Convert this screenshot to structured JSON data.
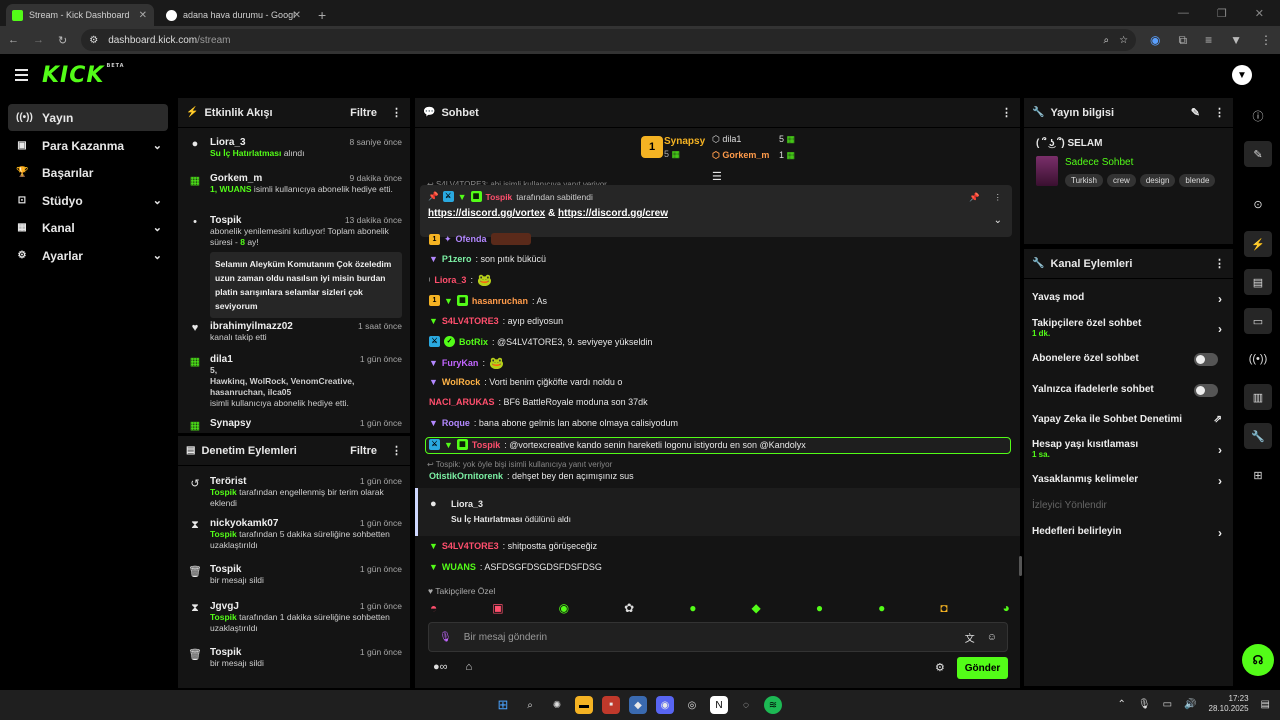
{
  "browser": {
    "tabs": [
      {
        "title": "Stream - Kick Dashboard",
        "active": true
      },
      {
        "title": "adana hava durumu - Google'd",
        "active": false
      }
    ],
    "new_tab": "+",
    "url_host": "dashboard.kick.com",
    "url_path": "/stream"
  },
  "brand": {
    "logo": "KICK",
    "logo_sup": "BETA",
    "accent": "#53fc18"
  },
  "nav": {
    "items": [
      {
        "label": "Yayın",
        "icon": "broadcast-icon",
        "active": true
      },
      {
        "label": "Para Kazanma",
        "icon": "money-icon",
        "expand": true
      },
      {
        "label": "Başarılar",
        "icon": "trophy-icon"
      },
      {
        "label": "Stüdyo",
        "icon": "studio-icon",
        "expand": true
      },
      {
        "label": "Kanal",
        "icon": "channel-icon",
        "expand": true
      },
      {
        "label": "Ayarlar",
        "icon": "settings-icon",
        "expand": true
      }
    ]
  },
  "activity": {
    "title": "Etkinlik Akışı",
    "filter": "Filtre",
    "items": [
      {
        "name": "Liora_3",
        "time": "8 saniye önce",
        "reward": "Su İç Hatırlatması",
        "text": " alındı"
      },
      {
        "name": "Gorkem_m",
        "time": "9 dakika önce",
        "count": "1, WUANS",
        "text": " isimli kullanıcıya abonelik hediye etti."
      },
      {
        "name": "Tospik",
        "time": "13 dakika önce",
        "text": "abonelik yenilemesini kutluyor! Toplam abonelik süresi - ",
        "months": "8",
        "suffix": " ay!",
        "quote": "Selamın Aleyküm Komutanım Çok özeledim uzun zaman oldu nasılsın iyi misin burdan platin sarışınlara selamlar sizleri çok seviyorum"
      },
      {
        "name": "ibrahimyilmazz02",
        "time": "1 saat önce",
        "text": "kanalı takip etti"
      },
      {
        "name": "dila1",
        "time": "1 gün önce",
        "count": "5,",
        "users": "Hawkinq, WolRock, VenomCreative, hasanruchan, ilca05",
        "text": "isimli kullanıcıya abonelik hediye etti."
      },
      {
        "name": "Synapsy",
        "time": "1 gün önce"
      }
    ]
  },
  "moderation": {
    "title": "Denetim Eylemleri",
    "filter": "Filtre",
    "items": [
      {
        "name": "Terörist",
        "time": "1 gün önce",
        "by": "Tospik",
        "text": " tarafından engellenmiş bir terim olarak eklendi",
        "icon": "undo-icon"
      },
      {
        "name": "nickyokamk07",
        "time": "1 gün önce",
        "by": "Tospik",
        "text": " tarafından 5 dakika süreliğine sohbetten uzaklaştırıldı",
        "icon": "hourglass-icon"
      },
      {
        "name": "Tospik",
        "time": "1 gün önce",
        "text": "bir mesajı sildi",
        "icon": "trash-icon"
      },
      {
        "name": "JgvgJ",
        "time": "1 gün önce",
        "by": "Tospik",
        "text": " tarafından 1 dakika süreliğine sohbetten uzaklaştırıldı",
        "icon": "hourglass-icon"
      },
      {
        "name": "Tospik",
        "time": "1 gün önce",
        "text": "bir mesajı sildi",
        "icon": "trash-icon"
      }
    ]
  },
  "chat": {
    "title": "Sohbet",
    "leaders": [
      {
        "rank": "1",
        "name": "Synapsy",
        "count": "5"
      },
      {
        "name": "dila1",
        "count": "5"
      },
      {
        "name": "Gorkem_m",
        "count": "1"
      }
    ],
    "reply_top": "S4LV4TORE3: abi isimli kullanıcıya yanıt veriyor",
    "pinned": {
      "user": "Tospik",
      "label": " tarafından sabitlendi",
      "link1": "https://discord.gg/vortex",
      "amp": " & ",
      "link2": "https://discord.gg/crew"
    },
    "messages": [
      {
        "user": "Ofenda",
        "text": "",
        "color": "#b388ff"
      },
      {
        "user": "P1zero",
        "text": ": son pıtık bükücü",
        "color": "#7cf0a4"
      },
      {
        "user": "Liora_3",
        "text": ": ",
        "color": "#ff4f6d"
      },
      {
        "user": "hasanruchan",
        "text": ": As",
        "color": "#ff9b4a"
      },
      {
        "user": "S4LV4TORE3",
        "text": ": ayıp ediyosun",
        "color": "#ff4f6d"
      },
      {
        "user": "BotRix",
        "text": ": @S4LV4TORE3, 9. seviyeye yükseldin",
        "color": "#53fc18"
      },
      {
        "user": "FuryKan",
        "text": ": ",
        "color": "#c266ff"
      },
      {
        "user": "WolRock",
        "text": ": Vorti benim çiğköfte vardı noldu o",
        "color": "#ffb347"
      },
      {
        "user": "NACI_ARUKAS",
        "text": ": BF6 BattleRoyale moduna son 37dk",
        "color": "#ff4f6d"
      },
      {
        "user": "Roque",
        "text": ": bana abone gelmis lan abone olmaya calisiyodum",
        "color": "#b388ff"
      },
      {
        "user": "Tospik",
        "text": ": @vortexcreative kando senin hareketli logonu istiyordu en son @Kandolyx",
        "color": "#ff4f6d"
      }
    ],
    "reply_mid": "Tospik: yok öyle bişi isimli kullanıcıya yanıt veriyor",
    "otistik": {
      "user": "OtistikOrnitorenk",
      "text": ": dehşet bey den açımışınız sus"
    },
    "event": {
      "user": "Liora_3",
      "reward": "Su İç Hatırlatması",
      "text": " ödülünü aldı"
    },
    "after": [
      {
        "user": "S4LV4TORE3",
        "text": ": shitpostta görüşeceğiz",
        "color": "#ff4f6d"
      },
      {
        "user": "WUANS",
        "text": ": ASFDSGFDSGDSFDSFDSG",
        "color": "#53fc18"
      }
    ],
    "followers_label": "Takipçilere Özel",
    "input_placeholder": "Bir mesaj gönderin",
    "send": "Gönder"
  },
  "stream_info": {
    "title": "Yayın bilgisi",
    "stream_title": "( ՞ ͜ʖ ՞) SELAM",
    "category": "Sadece Sohbet",
    "tags": [
      "Turkish",
      "crew",
      "design",
      "blende"
    ]
  },
  "channel_actions": {
    "title": "Kanal Eylemleri",
    "items": [
      {
        "label": "Yavaş mod",
        "type": "chevron"
      },
      {
        "label": "Takipçilere özel sohbet",
        "sub": "1 dk.",
        "type": "chevron"
      },
      {
        "label": "Abonelere özel sohbet",
        "type": "toggle"
      },
      {
        "label": "Yalnızca ifadelerle sohbet",
        "type": "toggle"
      },
      {
        "label": "Yapay Zeka ile Sohbet Denetimi",
        "type": "external"
      },
      {
        "label": "Hesap yaşı kısıtlaması",
        "sub": "1 sa.",
        "type": "chevron"
      },
      {
        "label": "Yasaklanmış kelimeler",
        "type": "chevron"
      },
      {
        "label": "İzleyici Yönlendir",
        "type": "disabled"
      },
      {
        "label": "Hedefleri belirleyin",
        "type": "chevron"
      }
    ]
  },
  "taskbar": {
    "time": "17:23",
    "date": "28.10.2025"
  }
}
